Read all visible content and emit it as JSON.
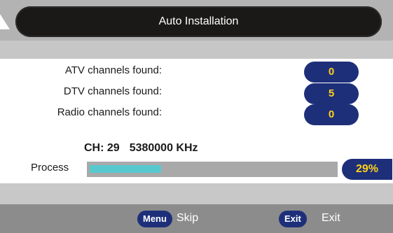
{
  "window": {
    "title": "Auto Installation"
  },
  "results": {
    "atv_label": "ATV channels found:",
    "atv_count": "0",
    "dtv_label": "DTV channels found:",
    "dtv_count": "5",
    "radio_label": "Radio channels found:",
    "radio_count": "0"
  },
  "scan": {
    "channel": "CH: 29",
    "frequency": "5380000 KHz"
  },
  "progress": {
    "label": "Process",
    "percent_text": "29%",
    "fraction": 0.29
  },
  "footer": {
    "menu_key": "Menu",
    "menu_action": "Skip",
    "exit_key": "Exit",
    "exit_action": "Exit"
  },
  "colors": {
    "accent": "#1e2f7a",
    "value_text": "#ffd21a",
    "progress_fill": "#58c8cf"
  }
}
